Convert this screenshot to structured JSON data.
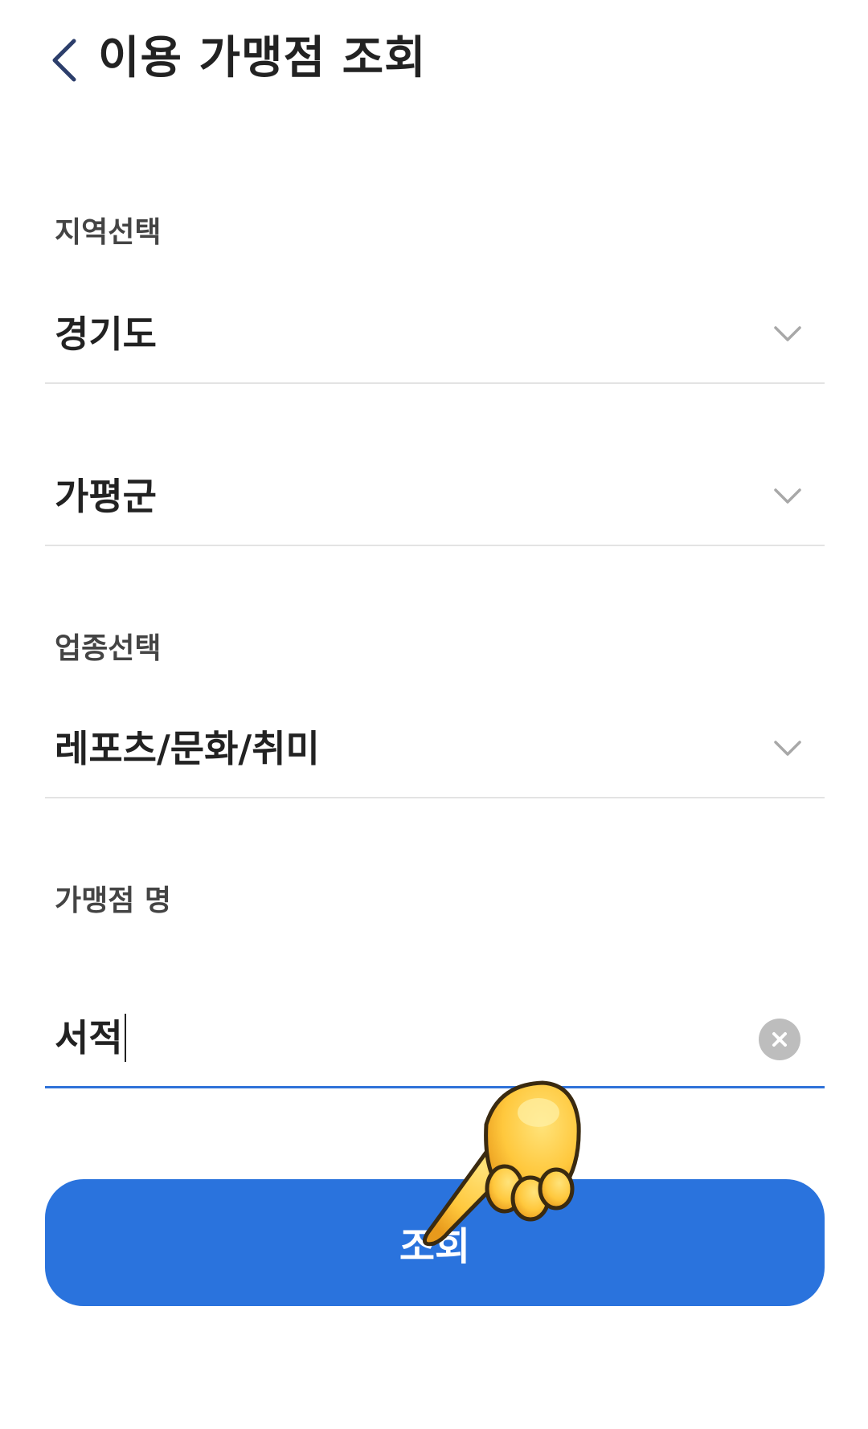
{
  "header": {
    "title": "이용 가맹점 조회",
    "back_icon": "chevron-left-icon"
  },
  "region": {
    "label": "지역선택",
    "province_value": "경기도",
    "district_value": "가평군"
  },
  "category": {
    "label": "업종선택",
    "value": "레포츠/문화/취미"
  },
  "merchant": {
    "label": "가맹점 명",
    "value": "서적",
    "clear_icon": "clear-circle-icon"
  },
  "submit": {
    "label": "조회"
  },
  "colors": {
    "accent": "#2a73dd",
    "text_primary": "#222222",
    "text_label": "#444444",
    "divider": "#e3e3e3",
    "back_icon": "#2c3e6b"
  },
  "overlay": {
    "icon": "pointing-hand-emoji"
  }
}
